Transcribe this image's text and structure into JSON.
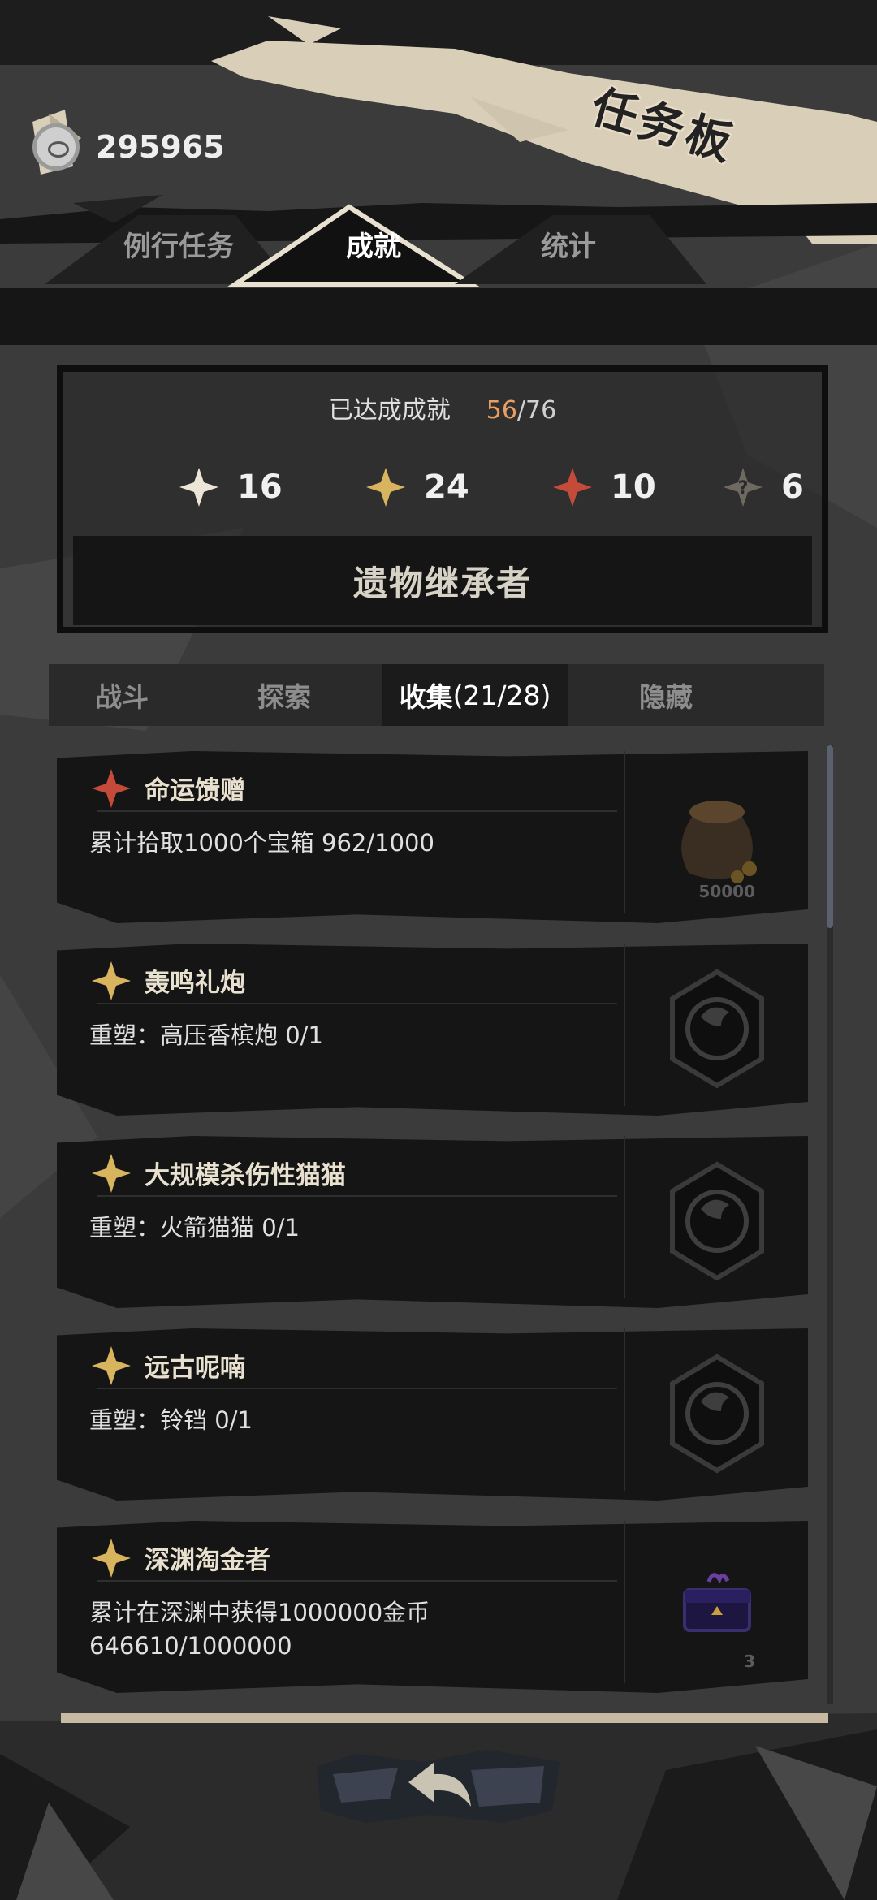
{
  "header": {
    "title": "任务板",
    "coin_value": "295965"
  },
  "main_tabs": [
    {
      "label": "例行任务",
      "active": false
    },
    {
      "label": "成就",
      "active": true
    },
    {
      "label": "统计",
      "active": false
    }
  ],
  "summary": {
    "label": "已达成成就",
    "current": "56",
    "separator": "/",
    "total": "76",
    "stats": [
      {
        "icon": "star-white-icon",
        "value": "16"
      },
      {
        "icon": "star-gold-icon",
        "value": "24"
      },
      {
        "icon": "star-red-icon",
        "value": "10"
      },
      {
        "icon": "star-hidden-icon",
        "value": "6"
      }
    ],
    "honor_title": "遗物继承者"
  },
  "category_tabs": [
    {
      "label": "战斗",
      "active": false
    },
    {
      "label": "探索",
      "active": false
    },
    {
      "label": "收集",
      "count": "(21/28)",
      "active": true
    },
    {
      "label": "隐藏",
      "active": false
    }
  ],
  "achievements": [
    {
      "title": "命运馈赠",
      "desc": "累计拾取1000个宝箱 962/1000",
      "star": "red",
      "reward": "coin-bag-icon",
      "reward_count": "50000"
    },
    {
      "title": "轰鸣礼炮",
      "desc": "重塑：高压香槟炮 0/1",
      "star": "gold",
      "reward": "locked-badge-icon",
      "reward_count": ""
    },
    {
      "title": "大规模杀伤性猫猫",
      "desc": "重塑：火箭猫猫 0/1",
      "star": "gold",
      "reward": "locked-badge-icon",
      "reward_count": ""
    },
    {
      "title": "远古呢喃",
      "desc": "重塑：铃铛 0/1",
      "star": "gold",
      "reward": "locked-badge-icon",
      "reward_count": ""
    },
    {
      "title": "深渊淘金者",
      "desc": "累计在深渊中获得1000000金币\n646610/1000000",
      "star": "gold",
      "reward": "chest-icon",
      "reward_count": "3"
    }
  ],
  "colors": {
    "gold": "#d9b45e",
    "red": "#c44a3a",
    "white": "#ece6d6",
    "accent_orange": "#e7a062",
    "banner": "#d9ceb8"
  }
}
